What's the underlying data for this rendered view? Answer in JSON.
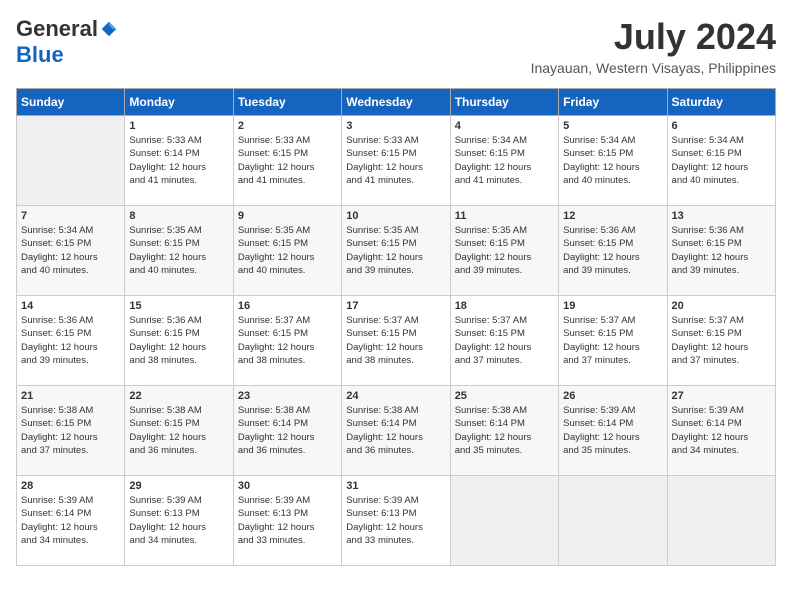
{
  "logo": {
    "general": "General",
    "blue": "Blue"
  },
  "title": "July 2024",
  "location": "Inayauan, Western Visayas, Philippines",
  "days_of_week": [
    "Sunday",
    "Monday",
    "Tuesday",
    "Wednesday",
    "Thursday",
    "Friday",
    "Saturday"
  ],
  "weeks": [
    [
      {
        "day": "",
        "info": ""
      },
      {
        "day": "1",
        "info": "Sunrise: 5:33 AM\nSunset: 6:14 PM\nDaylight: 12 hours\nand 41 minutes."
      },
      {
        "day": "2",
        "info": "Sunrise: 5:33 AM\nSunset: 6:15 PM\nDaylight: 12 hours\nand 41 minutes."
      },
      {
        "day": "3",
        "info": "Sunrise: 5:33 AM\nSunset: 6:15 PM\nDaylight: 12 hours\nand 41 minutes."
      },
      {
        "day": "4",
        "info": "Sunrise: 5:34 AM\nSunset: 6:15 PM\nDaylight: 12 hours\nand 41 minutes."
      },
      {
        "day": "5",
        "info": "Sunrise: 5:34 AM\nSunset: 6:15 PM\nDaylight: 12 hours\nand 40 minutes."
      },
      {
        "day": "6",
        "info": "Sunrise: 5:34 AM\nSunset: 6:15 PM\nDaylight: 12 hours\nand 40 minutes."
      }
    ],
    [
      {
        "day": "7",
        "info": "Sunrise: 5:34 AM\nSunset: 6:15 PM\nDaylight: 12 hours\nand 40 minutes."
      },
      {
        "day": "8",
        "info": "Sunrise: 5:35 AM\nSunset: 6:15 PM\nDaylight: 12 hours\nand 40 minutes."
      },
      {
        "day": "9",
        "info": "Sunrise: 5:35 AM\nSunset: 6:15 PM\nDaylight: 12 hours\nand 40 minutes."
      },
      {
        "day": "10",
        "info": "Sunrise: 5:35 AM\nSunset: 6:15 PM\nDaylight: 12 hours\nand 39 minutes."
      },
      {
        "day": "11",
        "info": "Sunrise: 5:35 AM\nSunset: 6:15 PM\nDaylight: 12 hours\nand 39 minutes."
      },
      {
        "day": "12",
        "info": "Sunrise: 5:36 AM\nSunset: 6:15 PM\nDaylight: 12 hours\nand 39 minutes."
      },
      {
        "day": "13",
        "info": "Sunrise: 5:36 AM\nSunset: 6:15 PM\nDaylight: 12 hours\nand 39 minutes."
      }
    ],
    [
      {
        "day": "14",
        "info": "Sunrise: 5:36 AM\nSunset: 6:15 PM\nDaylight: 12 hours\nand 39 minutes."
      },
      {
        "day": "15",
        "info": "Sunrise: 5:36 AM\nSunset: 6:15 PM\nDaylight: 12 hours\nand 38 minutes."
      },
      {
        "day": "16",
        "info": "Sunrise: 5:37 AM\nSunset: 6:15 PM\nDaylight: 12 hours\nand 38 minutes."
      },
      {
        "day": "17",
        "info": "Sunrise: 5:37 AM\nSunset: 6:15 PM\nDaylight: 12 hours\nand 38 minutes."
      },
      {
        "day": "18",
        "info": "Sunrise: 5:37 AM\nSunset: 6:15 PM\nDaylight: 12 hours\nand 37 minutes."
      },
      {
        "day": "19",
        "info": "Sunrise: 5:37 AM\nSunset: 6:15 PM\nDaylight: 12 hours\nand 37 minutes."
      },
      {
        "day": "20",
        "info": "Sunrise: 5:37 AM\nSunset: 6:15 PM\nDaylight: 12 hours\nand 37 minutes."
      }
    ],
    [
      {
        "day": "21",
        "info": "Sunrise: 5:38 AM\nSunset: 6:15 PM\nDaylight: 12 hours\nand 37 minutes."
      },
      {
        "day": "22",
        "info": "Sunrise: 5:38 AM\nSunset: 6:15 PM\nDaylight: 12 hours\nand 36 minutes."
      },
      {
        "day": "23",
        "info": "Sunrise: 5:38 AM\nSunset: 6:14 PM\nDaylight: 12 hours\nand 36 minutes."
      },
      {
        "day": "24",
        "info": "Sunrise: 5:38 AM\nSunset: 6:14 PM\nDaylight: 12 hours\nand 36 minutes."
      },
      {
        "day": "25",
        "info": "Sunrise: 5:38 AM\nSunset: 6:14 PM\nDaylight: 12 hours\nand 35 minutes."
      },
      {
        "day": "26",
        "info": "Sunrise: 5:39 AM\nSunset: 6:14 PM\nDaylight: 12 hours\nand 35 minutes."
      },
      {
        "day": "27",
        "info": "Sunrise: 5:39 AM\nSunset: 6:14 PM\nDaylight: 12 hours\nand 34 minutes."
      }
    ],
    [
      {
        "day": "28",
        "info": "Sunrise: 5:39 AM\nSunset: 6:14 PM\nDaylight: 12 hours\nand 34 minutes."
      },
      {
        "day": "29",
        "info": "Sunrise: 5:39 AM\nSunset: 6:13 PM\nDaylight: 12 hours\nand 34 minutes."
      },
      {
        "day": "30",
        "info": "Sunrise: 5:39 AM\nSunset: 6:13 PM\nDaylight: 12 hours\nand 33 minutes."
      },
      {
        "day": "31",
        "info": "Sunrise: 5:39 AM\nSunset: 6:13 PM\nDaylight: 12 hours\nand 33 minutes."
      },
      {
        "day": "",
        "info": ""
      },
      {
        "day": "",
        "info": ""
      },
      {
        "day": "",
        "info": ""
      }
    ]
  ]
}
